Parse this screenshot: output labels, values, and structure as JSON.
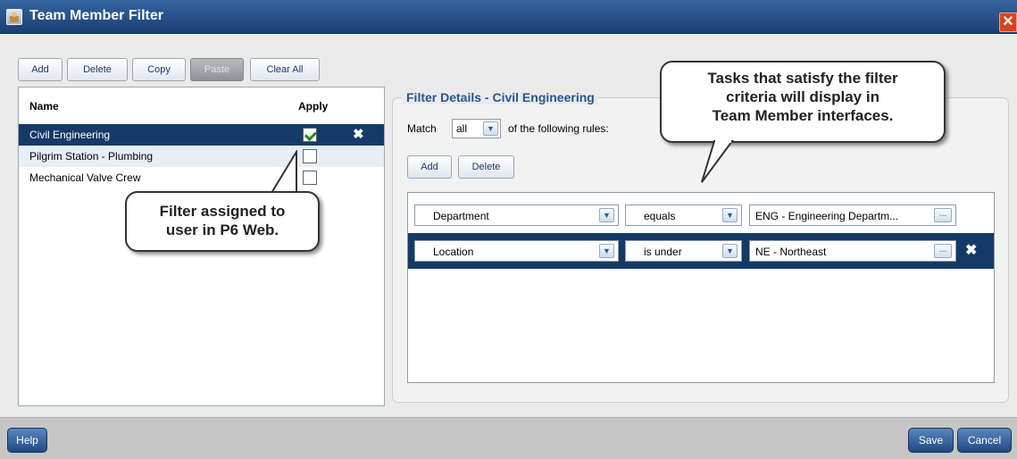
{
  "window": {
    "title": "Team Member Filter",
    "close_glyph": "✕",
    "icon": "app-window-icon"
  },
  "toolbar": {
    "add": "Add",
    "delete": "Delete",
    "copy": "Copy",
    "paste": "Paste",
    "clear_all": "Clear All"
  },
  "filter_list": {
    "columns": {
      "name": "Name",
      "apply": "Apply"
    },
    "rows": [
      {
        "name": "Civil Engineering",
        "applied": true,
        "selected": true
      },
      {
        "name": "Pilgrim Station - Plumbing",
        "applied": false
      },
      {
        "name": "Mechanical Valve Crew",
        "applied": false
      }
    ],
    "remove_glyph": "✖"
  },
  "details": {
    "title": "Filter Details - Civil Engineering",
    "match_label": "Match",
    "match_value": "all",
    "match_suffix": "of the following rules:",
    "add": "Add",
    "delete": "Delete",
    "rules": [
      {
        "field": "Department",
        "operator": "equals",
        "value": "ENG - Engineering Departm..."
      },
      {
        "field": "Location",
        "operator": "is under",
        "value": "NE - Northeast",
        "selected": true
      }
    ],
    "ellipsis": "...",
    "dropdown_glyph": "▼"
  },
  "callouts": {
    "left": "Filter assigned to\nuser in P6 Web.",
    "right": "Tasks that satisfy the filter\ncriteria will display in\nTeam Member interfaces."
  },
  "footer": {
    "help": "Help",
    "save": "Save",
    "cancel": "Cancel"
  },
  "colors": {
    "titlebar": "#1b3f73",
    "selected_row": "#163a67",
    "accent_text": "#28558e",
    "close": "#d9431e"
  }
}
